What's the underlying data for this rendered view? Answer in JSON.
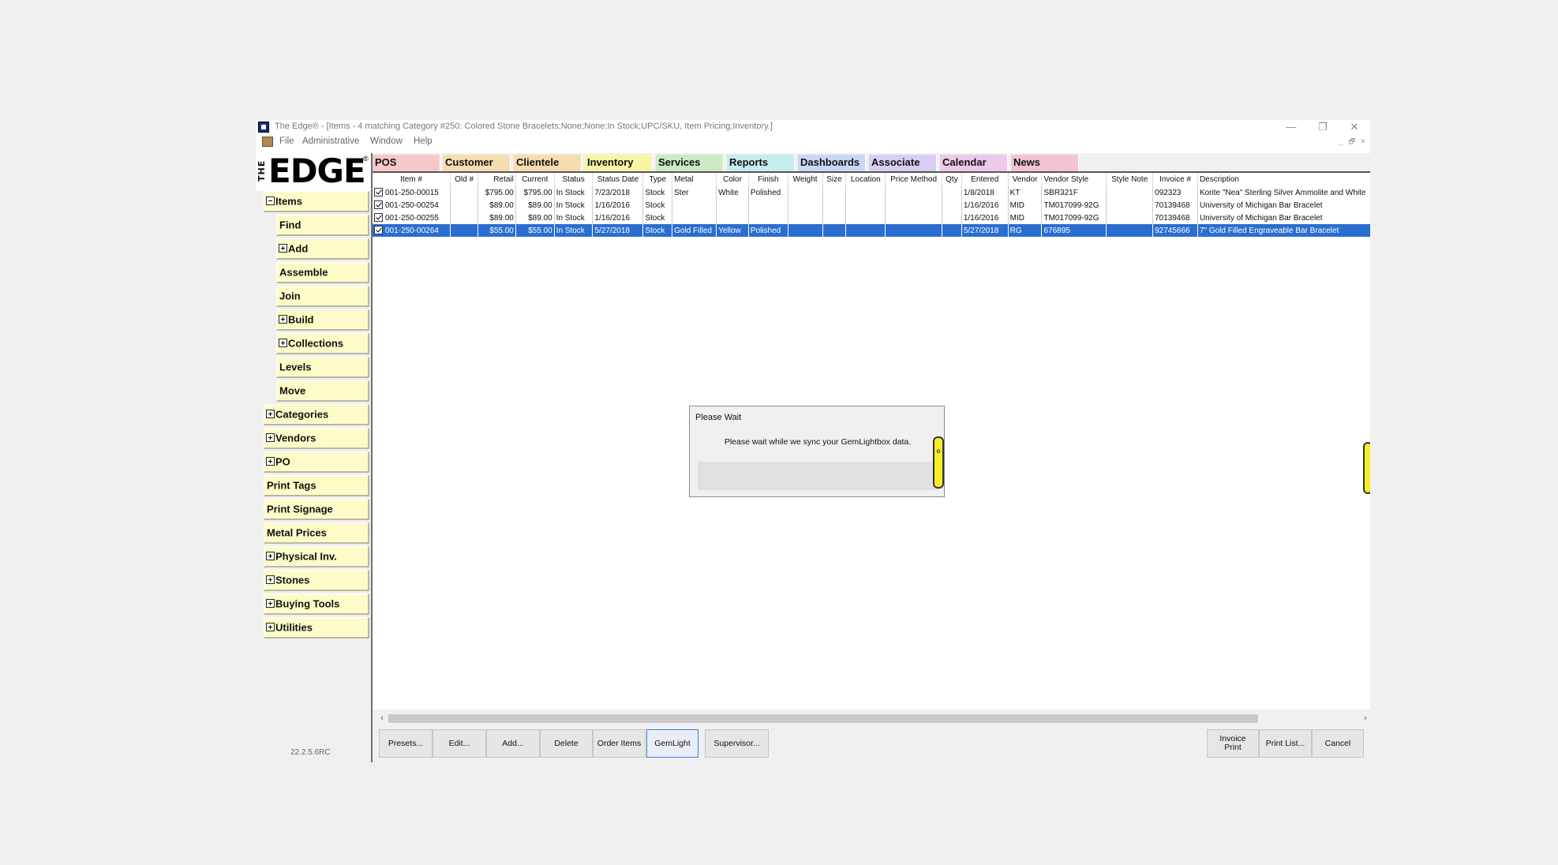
{
  "window": {
    "title": "The Edge® - [Items - 4 matching Category #250: Colored Stone Bracelets;None;None;In Stock;UPC/SKU, Item Pricing;Inventory.]",
    "minimize": "—",
    "restore": "❐",
    "close": "✕"
  },
  "menu": [
    "File",
    "Administrative",
    "Window",
    "Help"
  ],
  "mdi_controls": [
    "_",
    "🗗",
    "✕"
  ],
  "logo": {
    "the": "THE",
    "edge": "EDGE",
    "reg": "®"
  },
  "sidebar": {
    "items": [
      {
        "label": "Items",
        "expander": "minus"
      },
      {
        "label": "Find",
        "expander": "none"
      },
      {
        "label": "Add",
        "expander": "plus"
      },
      {
        "label": "Assemble",
        "expander": "none"
      },
      {
        "label": "Join",
        "expander": "none"
      },
      {
        "label": "Build",
        "expander": "plus"
      },
      {
        "label": "Collections",
        "expander": "plus"
      },
      {
        "label": "Levels",
        "expander": "none"
      },
      {
        "label": "Move",
        "expander": "none"
      },
      {
        "label": "Categories",
        "expander": "plus"
      },
      {
        "label": "Vendors",
        "expander": "plus"
      },
      {
        "label": "PO",
        "expander": "plus"
      },
      {
        "label": "Print Tags",
        "expander": "none"
      },
      {
        "label": "Print Signage",
        "expander": "none"
      },
      {
        "label": "Metal Prices",
        "expander": "none"
      },
      {
        "label": "Physical Inv.",
        "expander": "plus"
      },
      {
        "label": "Stones",
        "expander": "plus"
      },
      {
        "label": "Buying Tools",
        "expander": "plus"
      },
      {
        "label": "Utilities",
        "expander": "plus"
      }
    ],
    "version": "22.2.5.6RC"
  },
  "tabs": [
    {
      "label": "POS",
      "color": "#f7c8c8"
    },
    {
      "label": "Customer",
      "color": "#f7dcb0"
    },
    {
      "label": "Clientele",
      "color": "#f7dcb0"
    },
    {
      "label": "Inventory",
      "color": "#f9f3a6"
    },
    {
      "label": "Services",
      "color": "#cdeac4"
    },
    {
      "label": "Reports",
      "color": "#c7ecef"
    },
    {
      "label": "Dashboards",
      "color": "#c8d7f5"
    },
    {
      "label": "Associate",
      "color": "#d9cdf3"
    },
    {
      "label": "Calendar",
      "color": "#edc8ea"
    },
    {
      "label": "News",
      "color": "#f3c3d2"
    }
  ],
  "grid": {
    "columns": [
      "Item #",
      "Old #",
      "Retail",
      "Current",
      "Status",
      "Status Date",
      "Type",
      "Metal",
      "Color",
      "Finish",
      "Weight",
      "Size",
      "Location",
      "Price Method",
      "Qty",
      "Entered",
      "Vendor",
      "Vendor Style",
      "Style Note",
      "Invoice #",
      "Description"
    ],
    "rows": [
      {
        "checked": true,
        "selected": false,
        "cells": [
          "001-250-00015",
          "",
          "$795.00",
          "$795.00",
          "In Stock",
          "7/23/2018",
          "Stock",
          "Ster",
          "White",
          "Polished",
          "",
          "",
          "",
          "",
          "",
          "1/8/2018",
          "KT",
          "SBR321F",
          "",
          "092323",
          "Korite \"Nea\" Sterling Silver Ammolite and White"
        ]
      },
      {
        "checked": true,
        "selected": false,
        "cells": [
          "001-250-00254",
          "",
          "$89.00",
          "$89.00",
          "In Stock",
          "1/16/2016",
          "Stock",
          "",
          "",
          "",
          "",
          "",
          "",
          "",
          "",
          "1/16/2016",
          "MID",
          "TM017099-92G",
          "",
          "70139468",
          "University of Michigan Bar Bracelet"
        ]
      },
      {
        "checked": true,
        "selected": false,
        "cells": [
          "001-250-00255",
          "",
          "$89.00",
          "$89.00",
          "In Stock",
          "1/16/2016",
          "Stock",
          "",
          "",
          "",
          "",
          "",
          "",
          "",
          "",
          "1/16/2016",
          "MID",
          "TM017099-92G",
          "",
          "70139468",
          "University of Michigan Bar Bracelet"
        ]
      },
      {
        "checked": true,
        "selected": true,
        "cells": [
          "001-250-00264",
          "",
          "$55.00",
          "$55.00",
          "In Stock",
          "5/27/2018",
          "Stock",
          "Gold Filled",
          "Yellow",
          "Polished",
          "",
          "",
          "",
          "",
          "",
          "5/27/2018",
          "RG",
          "676895",
          "",
          "92745666",
          "7\" Gold Filled Engraveable Bar Bracelet"
        ]
      }
    ]
  },
  "scrollbar": {
    "left": "‹",
    "right": "›"
  },
  "buttons": {
    "presets": "Presets...",
    "edit": "Edit...",
    "add": "Add...",
    "delete": "Delete",
    "order_items": "Order Items",
    "gemlight": "GemLight",
    "supervisor": "Supervisor...",
    "invoice_print": "Invoice Print",
    "print_list": "Print List...",
    "cancel": "Cancel"
  },
  "dialog": {
    "title": "Please Wait",
    "message": "Please wait while we sync your GemLightbox data."
  }
}
